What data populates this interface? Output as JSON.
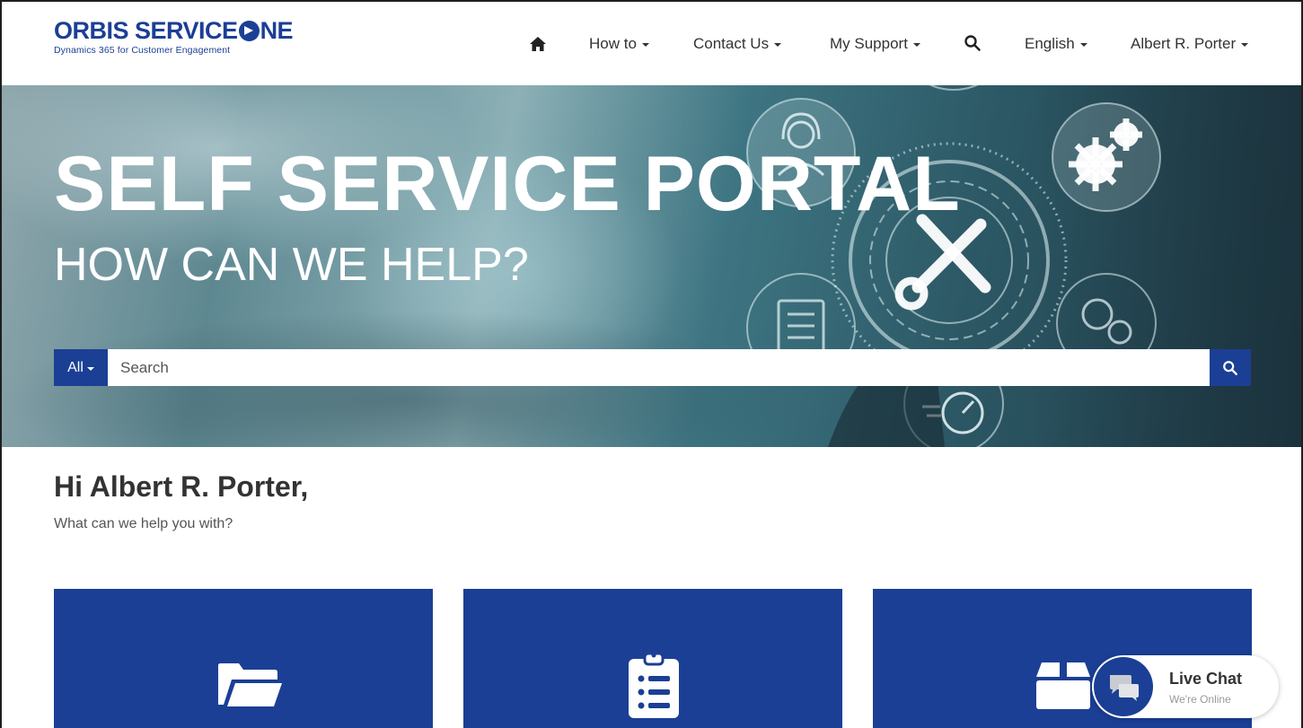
{
  "brand": {
    "name_part1": "ORBIS SERVICE",
    "name_part2": "NE",
    "tagline": "Dynamics 365 for Customer Engagement"
  },
  "nav": {
    "items": [
      {
        "label": "How to"
      },
      {
        "label": "Contact Us"
      },
      {
        "label": "My Support"
      },
      {
        "label": "English"
      },
      {
        "label": "Albert R. Porter"
      }
    ]
  },
  "hero": {
    "title": "SELF SERVICE PORTAL",
    "subtitle": "HOW CAN WE HELP?"
  },
  "search": {
    "filter_label": "All",
    "placeholder": "Search"
  },
  "greeting": {
    "title": "Hi Albert R. Porter,",
    "subtitle": "What can we help you with?"
  },
  "tiles": [
    {
      "icon": "folder-open-icon"
    },
    {
      "icon": "clipboard-list-icon"
    },
    {
      "icon": "box-icon"
    }
  ],
  "live_chat": {
    "title": "Live Chat",
    "status": "We're Online"
  },
  "colors": {
    "brand_blue": "#1b3f95"
  }
}
